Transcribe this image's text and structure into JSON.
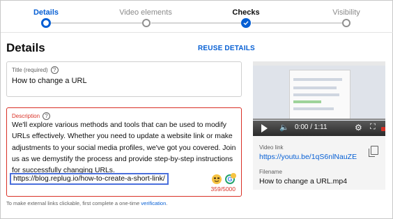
{
  "stepper": {
    "steps": [
      {
        "label": "Details",
        "state": "current"
      },
      {
        "label": "Video elements",
        "state": "pending"
      },
      {
        "label": "Checks",
        "state": "done"
      },
      {
        "label": "Visibility",
        "state": "pending"
      }
    ]
  },
  "header": {
    "title": "Details",
    "reuse_label": "REUSE DETAILS"
  },
  "title_field": {
    "label": "Title (required)",
    "help_icon": "?",
    "value": "How to change a URL"
  },
  "description_field": {
    "label": "Description",
    "help_icon": "?",
    "text": "We'll explore various methods and tools that can be used to modify URLs effectively. Whether you need to update a website link or make adjustments to your social media profiles, we've got you covered. Join us as we demystify the process and provide step-by-step instructions for successfully changing URLs.",
    "link": "https://blog.replug.io/how-to-create-a-short-link/",
    "counter": "359/5000"
  },
  "hint": {
    "text": "To make external links clickable, first complete a one-time ",
    "link": "verification",
    "suffix": "."
  },
  "video": {
    "time": "0:00 / 1:11",
    "link_label": "Video link",
    "link": "https://youtu.be/1qS6nlNauZE",
    "filename_label": "Filename",
    "filename": "How to change a URL.mp4"
  },
  "colors": {
    "accent": "#065fd4",
    "error": "#d93025"
  }
}
